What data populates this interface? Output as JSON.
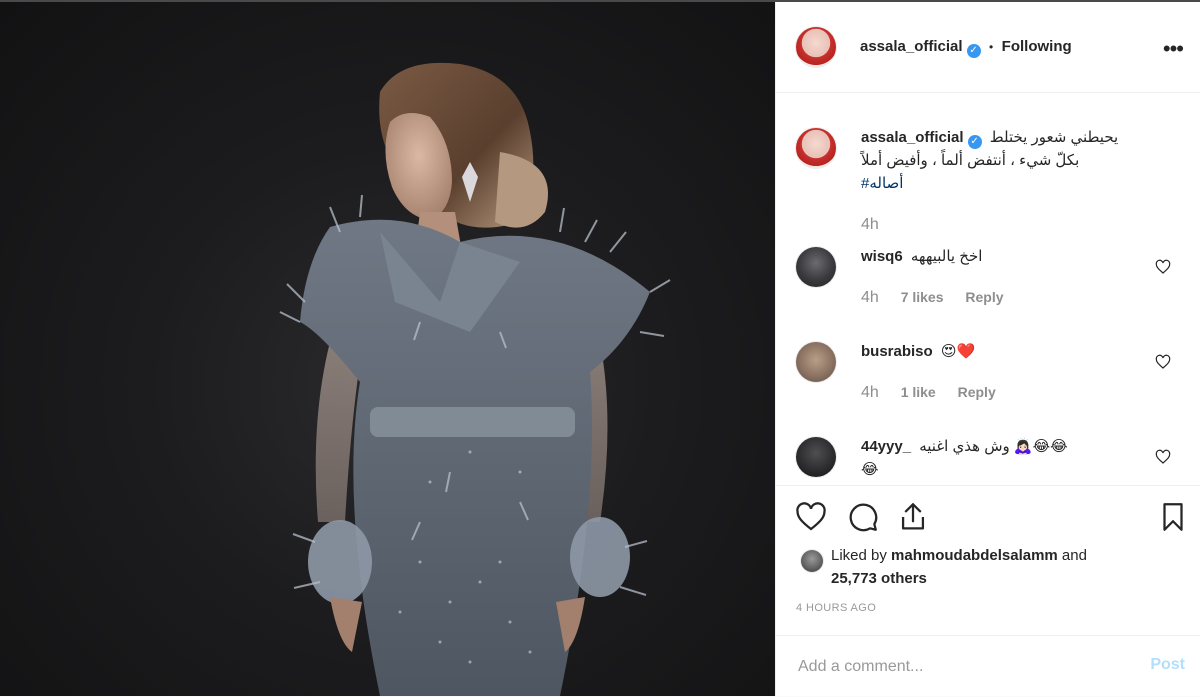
{
  "post": {
    "username": "assala_official",
    "follow_sep": "•",
    "follow_label": "Following",
    "caption_line1": "يحيطني شعور يختلط",
    "caption_line2": "بكلّ شيء ، أنتفض ألماً ، وأفيض أملاً",
    "hashtag": "#أصاله",
    "caption_time": "4h"
  },
  "comments": [
    {
      "username": "wisq6",
      "text": "اخخ يالبيههه",
      "time": "4h",
      "likes": "7 likes",
      "reply": "Reply"
    },
    {
      "username": "busrabiso",
      "text": "😍❤️",
      "time": "4h",
      "likes": "1 like",
      "reply": "Reply"
    },
    {
      "username": "44yyy_",
      "text": "وش هذي اغنيه 🙇🏻‍♀️😂😂",
      "text_line2": "😂"
    }
  ],
  "likes": {
    "prefix": "Liked by ",
    "liker": "mahmoudabdelsalamm",
    "and": " and",
    "others": "25,773 others"
  },
  "timestamp": "4 HOURS AGO",
  "add_comment": {
    "placeholder": "Add a comment...",
    "post_label": "Post"
  },
  "colors": {
    "accent": "#3897f0",
    "post_disabled": "#b2dffc",
    "hashtag": "#003569",
    "muted": "#8e8e8e"
  },
  "icons": [
    "verified-badge-icon",
    "more-options-icon",
    "heart-icon",
    "comment-icon",
    "share-icon",
    "bookmark-icon",
    "like-comment-heart-icon"
  ]
}
